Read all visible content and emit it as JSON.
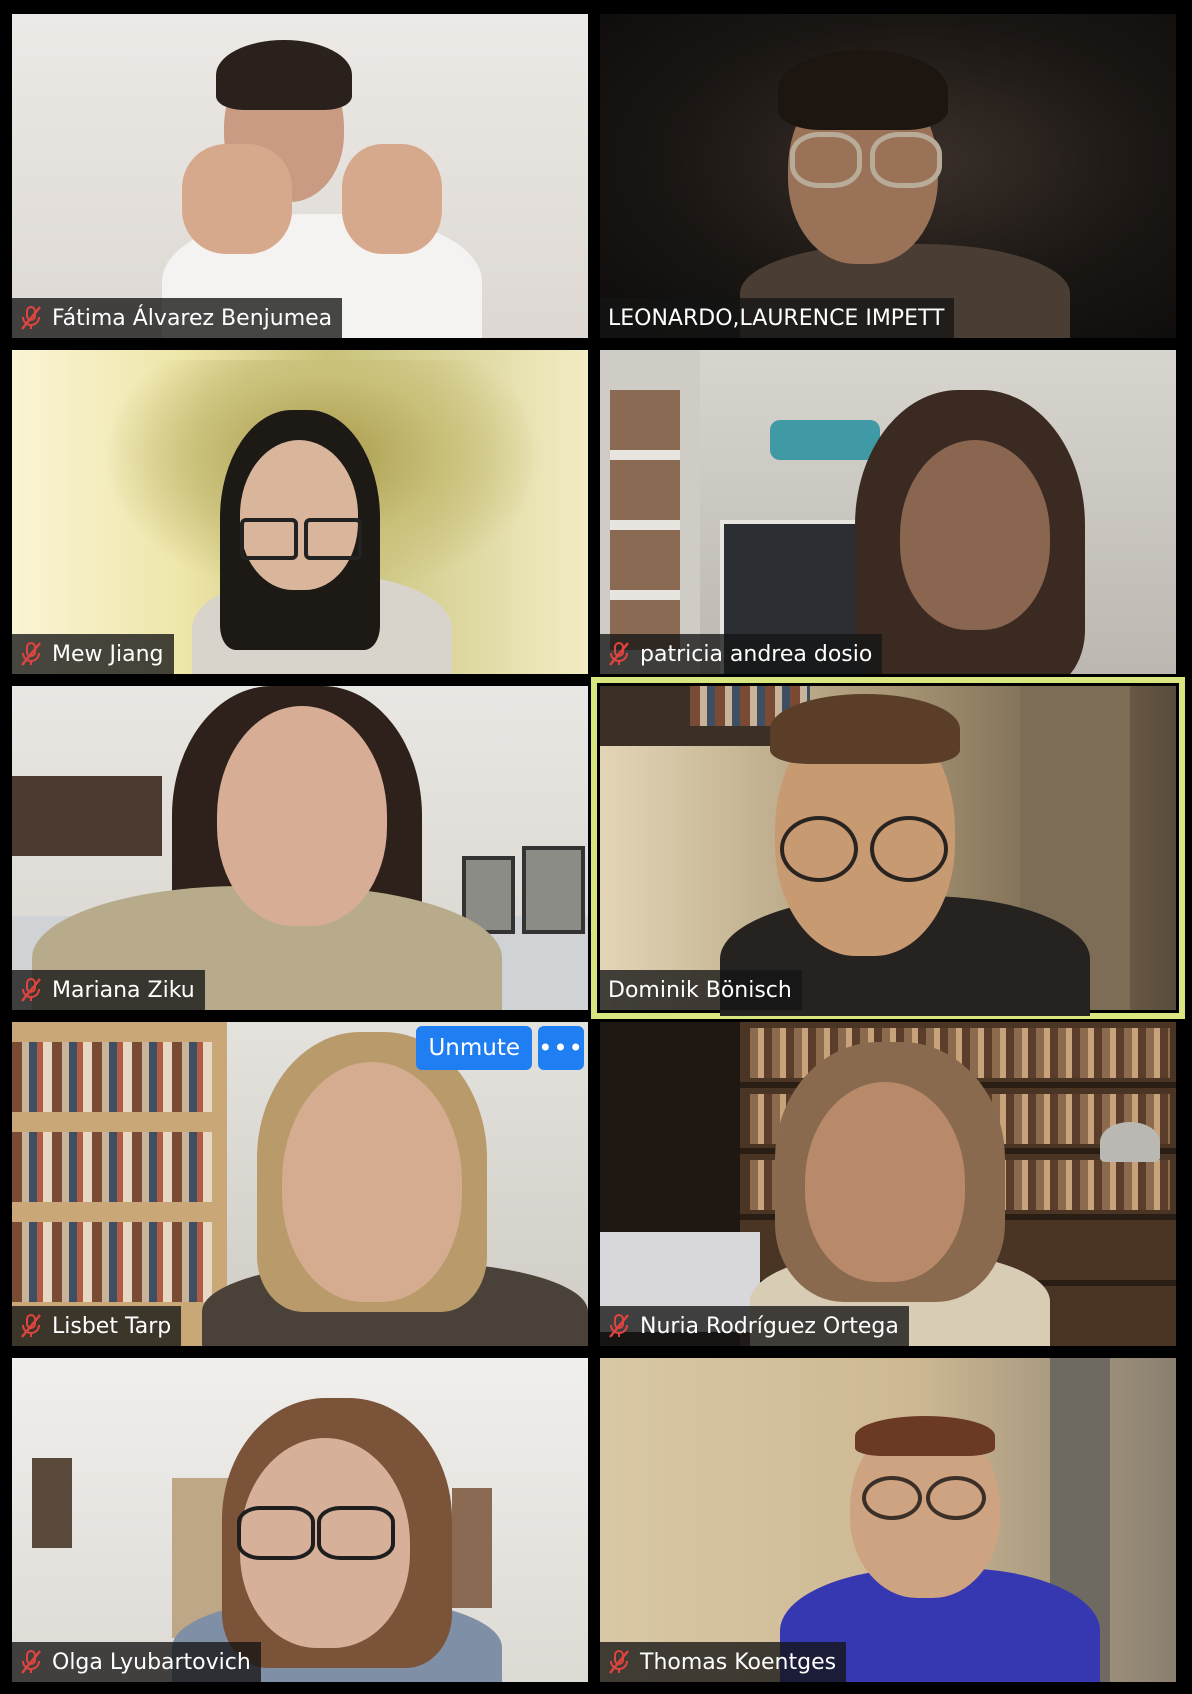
{
  "participants": [
    {
      "name": "Fátima Álvarez Benjumea",
      "muted": true
    },
    {
      "name": "LEONARDO,LAURENCE IMPETT",
      "muted": false
    },
    {
      "name": "Mew Jiang",
      "muted": true
    },
    {
      "name": "patricia andrea dosio",
      "muted": true
    },
    {
      "name": "Mariana Ziku",
      "muted": true
    },
    {
      "name": "Dominik Bönisch",
      "muted": false,
      "active_speaker": true
    },
    {
      "name": "Lisbet Tarp",
      "muted": true
    },
    {
      "name": "Nuria Rodríguez Ortega",
      "muted": true
    },
    {
      "name": "Olga Lyubartovich",
      "muted": true
    },
    {
      "name": "Thomas Koentges",
      "muted": true
    }
  ],
  "hover_controls": {
    "unmute_label": "Unmute",
    "more_label": "•••"
  },
  "colors": {
    "active_speaker_border": "#d9e67f",
    "button_blue": "#1f7ef2",
    "muted_icon": "#e0443e"
  }
}
